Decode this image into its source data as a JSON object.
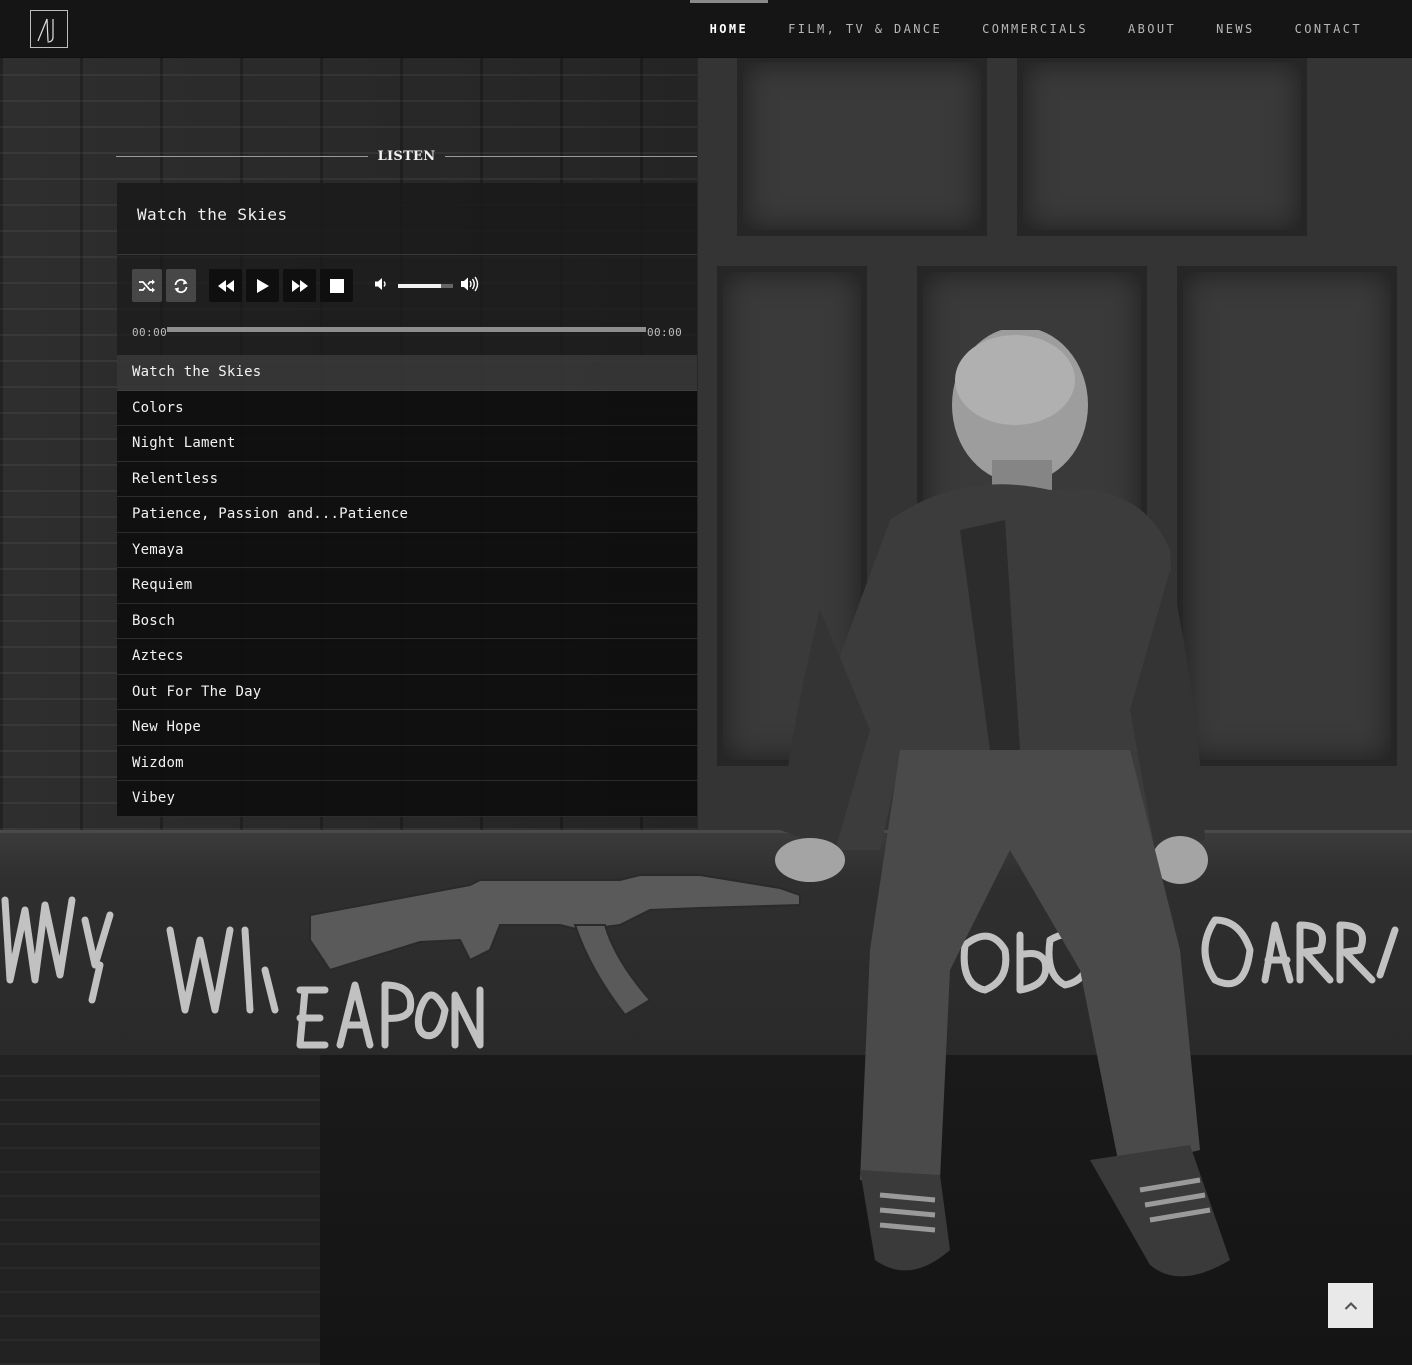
{
  "brand": {
    "logo_text": "AJ"
  },
  "nav": {
    "items": [
      {
        "label": "HOME",
        "active": true
      },
      {
        "label": "FILM, TV & DANCE"
      },
      {
        "label": "COMMERCIALS"
      },
      {
        "label": "ABOUT"
      },
      {
        "label": "NEWS"
      },
      {
        "label": "CONTACT"
      }
    ]
  },
  "listen": {
    "section_title": "LISTEN",
    "now_playing": "Watch the Skies",
    "current_time": "00:00",
    "duration": "00:00",
    "progress": 0,
    "volume": 0.78,
    "controls": {
      "shuffle_icon": "shuffle-icon",
      "repeat_icon": "repeat-icon",
      "prev_icon": "previous-icon",
      "play_icon": "play-icon",
      "next_icon": "next-icon",
      "stop_icon": "stop-icon",
      "mute_icon": "volume-low-icon",
      "volume_max_icon": "volume-high-icon"
    },
    "tracks": [
      "Watch the Skies",
      "Colors",
      "Night Lament",
      "Relentless",
      "Patience, Passion and...Patience",
      "Yemaya",
      "Requiem",
      "Bosch",
      "Aztecs",
      "Out For The Day",
      "New Hope",
      "Wizdom",
      "Vibey"
    ],
    "current_track_index": 0
  },
  "back_to_top": {
    "icon": "chevron-up-icon"
  },
  "colors": {
    "header_bg": "#141414",
    "accent": "#8a8a8a",
    "text": "#f2f2f2",
    "back_to_top_bg": "#e9e9e9"
  }
}
